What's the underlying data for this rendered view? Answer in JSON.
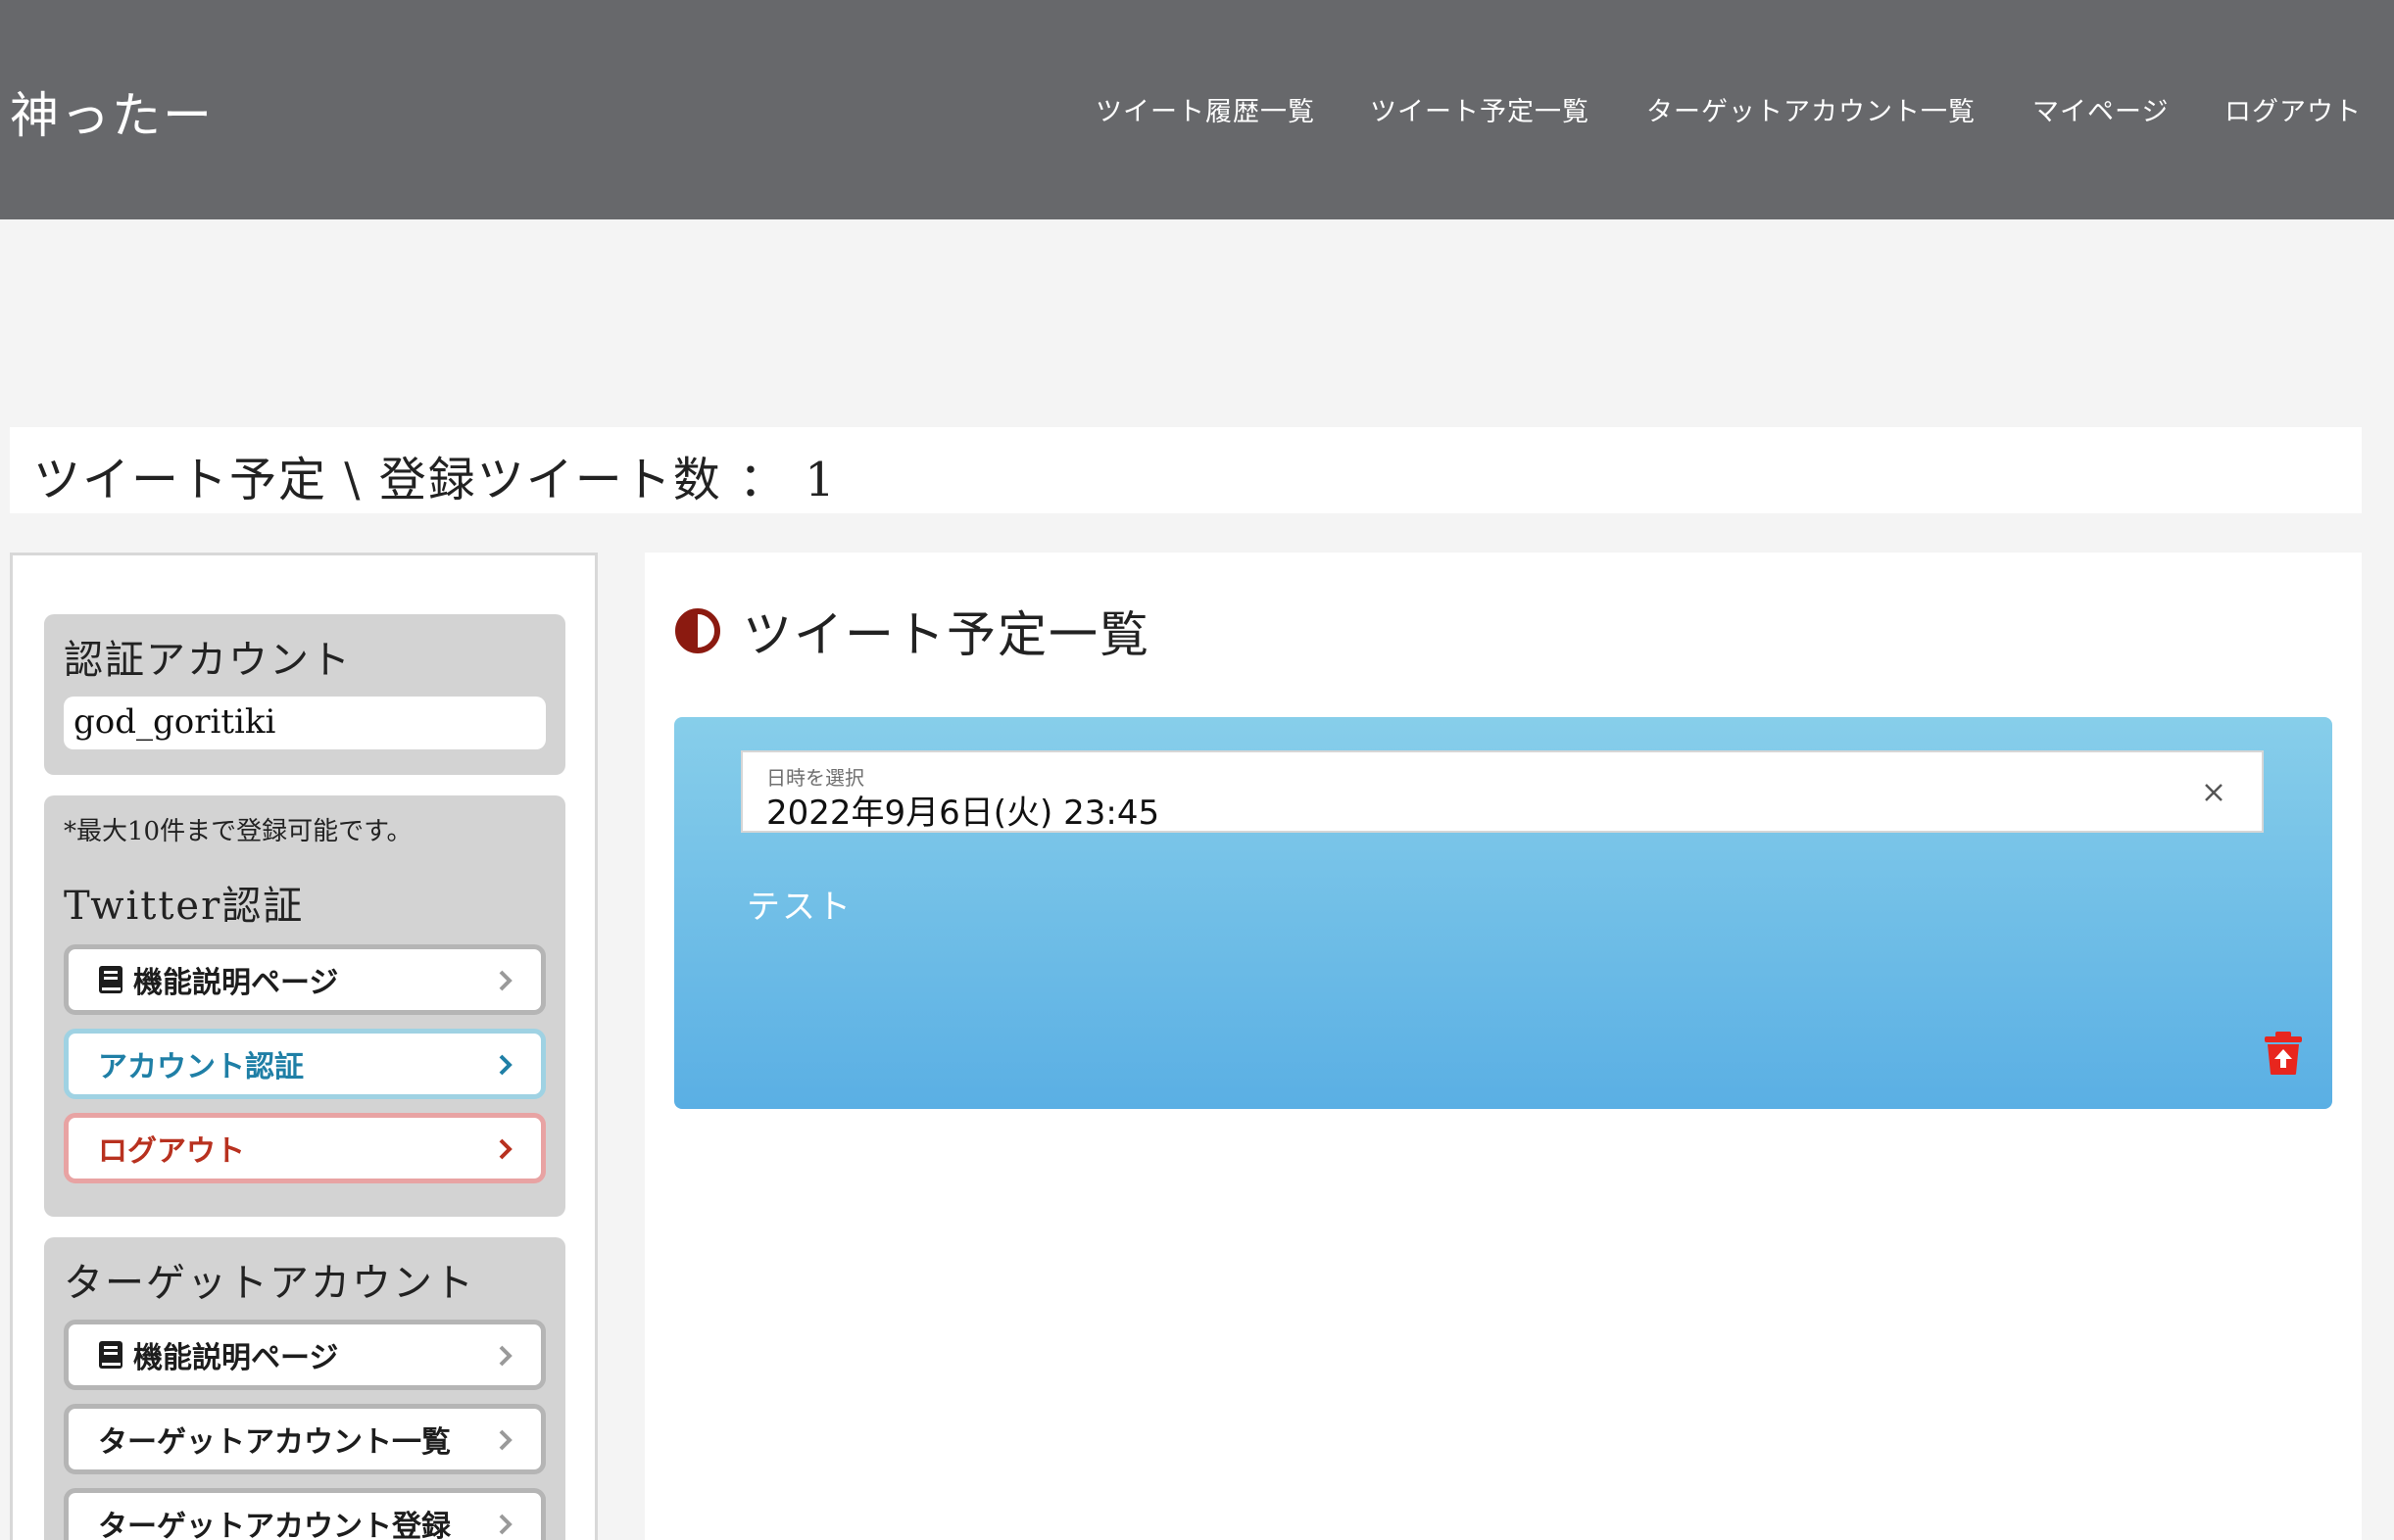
{
  "header": {
    "logo": "神ったー",
    "nav": [
      {
        "label": "ツイート履歴一覧"
      },
      {
        "label": "ツイート予定一覧"
      },
      {
        "label": "ターゲットアカウント一覧"
      },
      {
        "label": "マイページ"
      },
      {
        "label": "ログアウト"
      }
    ],
    "bg_color": "#67686b"
  },
  "page_title": "ツイート予定 \\ 登録ツイート数 ： 1",
  "sidebar": {
    "auth_account": {
      "heading": "認証アカウント",
      "value": "god_goritiki"
    },
    "twitter_auth": {
      "note": "*最大10件まで登録可能です。",
      "heading": "Twitter認証",
      "buttons": [
        {
          "label": "機能説明ページ",
          "icon": "book-icon"
        },
        {
          "label": "アカウント認証",
          "color": "#1f7fa6"
        },
        {
          "label": "ログアウト",
          "color": "#b8311f"
        }
      ]
    },
    "target_account": {
      "heading": "ターゲットアカウント",
      "buttons": [
        {
          "label": "機能説明ページ",
          "icon": "book-icon"
        },
        {
          "label": "ターゲットアカウント一覧"
        },
        {
          "label": "ターゲットアカウント登録"
        }
      ]
    }
  },
  "main": {
    "title": "ツイート予定一覧",
    "title_icon": "half-circle-icon",
    "accent_color": "#8b1a10",
    "tweet": {
      "date_label": "日時を選択",
      "date_value": "2022年9月6日(火) 23:45",
      "text": "テスト",
      "delete_icon": "trash-icon",
      "delete_color": "#e8261e"
    }
  }
}
